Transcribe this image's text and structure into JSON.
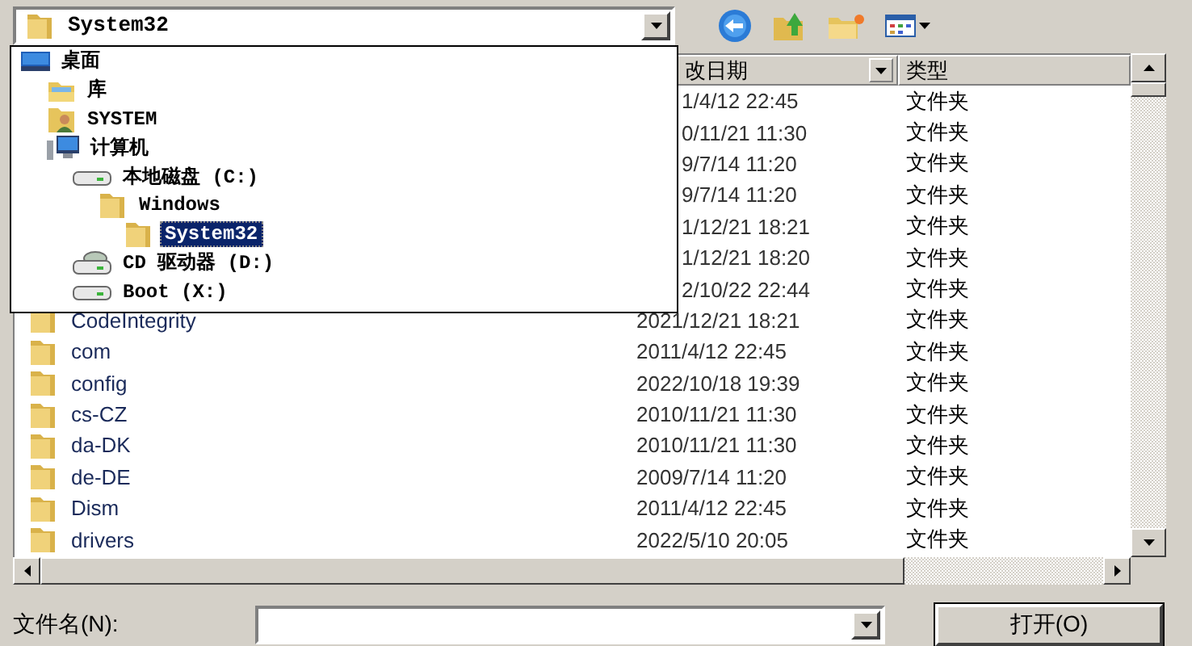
{
  "location": {
    "value": "System32"
  },
  "location_menu": {
    "items": [
      {
        "label": "桌面",
        "kind": "desktop",
        "selected": false,
        "children": [
          {
            "label": "库",
            "kind": "library",
            "selected": false
          },
          {
            "label": "SYSTEM",
            "kind": "user",
            "selected": false
          },
          {
            "label": "计算机",
            "kind": "computer",
            "selected": false,
            "children": [
              {
                "label": "本地磁盘 (C:)",
                "kind": "drive",
                "selected": false,
                "children": [
                  {
                    "label": "Windows",
                    "kind": "folder",
                    "selected": false,
                    "children": [
                      {
                        "label": "System32",
                        "kind": "folder",
                        "selected": true
                      }
                    ]
                  }
                ]
              },
              {
                "label": "CD 驱动器 (D:)",
                "kind": "cd",
                "selected": false
              },
              {
                "label": "Boot (X:)",
                "kind": "drive",
                "selected": false
              }
            ]
          }
        ]
      }
    ]
  },
  "list": {
    "columns": [
      "改日期",
      "类型"
    ],
    "rows": [
      {
        "date": "1/4/12 22:45",
        "type": "文件夹"
      },
      {
        "date": "0/11/21 11:30",
        "type": "文件夹"
      },
      {
        "date": "9/7/14 11:20",
        "type": "文件夹"
      },
      {
        "date": "9/7/14 11:20",
        "type": "文件夹"
      },
      {
        "date": "1/12/21 18:21",
        "type": "文件夹"
      },
      {
        "date": "1/12/21 18:20",
        "type": "文件夹"
      },
      {
        "date": "2/10/22 22:44",
        "type": "文件夹"
      },
      {
        "name": "CodeIntegrity",
        "date": "2021/12/21 18:21",
        "type": "文件夹"
      },
      {
        "name": "com",
        "date": "2011/4/12 22:45",
        "type": "文件夹"
      },
      {
        "name": "config",
        "date": "2022/10/18 19:39",
        "type": "文件夹"
      },
      {
        "name": "cs-CZ",
        "date": "2010/11/21 11:30",
        "type": "文件夹"
      },
      {
        "name": "da-DK",
        "date": "2010/11/21 11:30",
        "type": "文件夹"
      },
      {
        "name": "de-DE",
        "date": "2009/7/14 11:20",
        "type": "文件夹"
      },
      {
        "name": "Dism",
        "date": "2011/4/12 22:45",
        "type": "文件夹"
      },
      {
        "name": "drivers",
        "date": "2022/5/10 20:05",
        "type": "文件夹"
      }
    ]
  },
  "file_name": {
    "label": "文件名(N):"
  },
  "buttons": [
    "打开(O)"
  ]
}
